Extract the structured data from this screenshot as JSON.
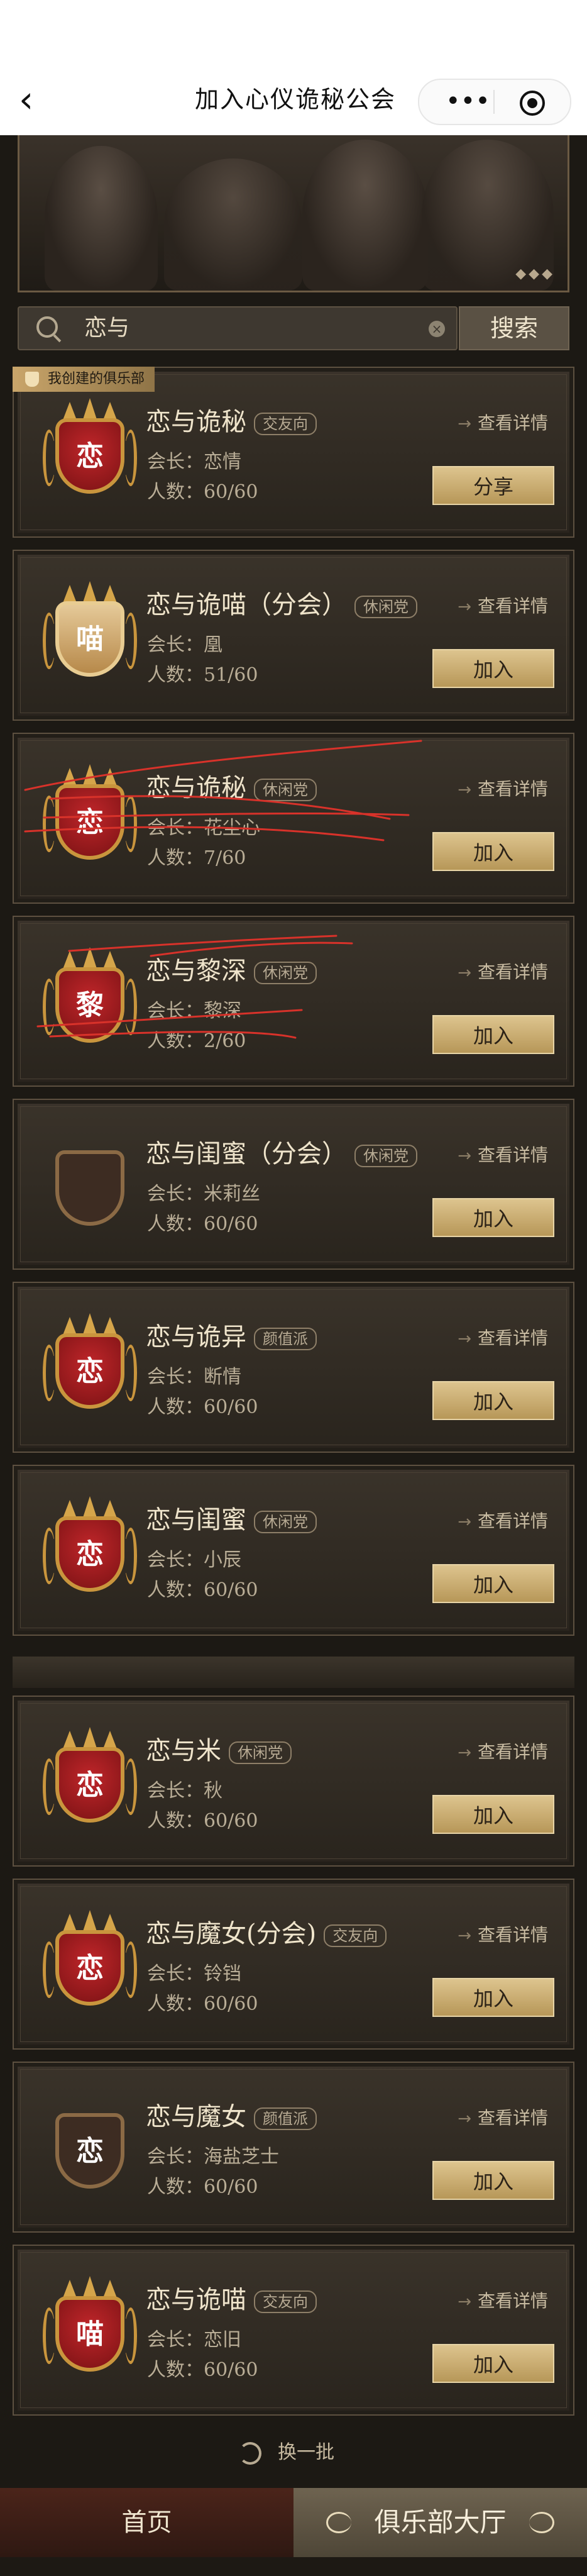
{
  "header": {
    "back_icon": "chevron-left-icon",
    "title": "加入心仪诡秘公会",
    "more_icon": "more-dots-icon",
    "close_icon": "target-circle-icon"
  },
  "search": {
    "value": "恋与",
    "button": "搜索"
  },
  "mine_badge": "我创建的俱乐部",
  "detail_label": "查看详情",
  "clubs": [
    {
      "emblem": "恋",
      "name": "恋与诡秘",
      "tag": "交友向",
      "leader": "会长：恋情",
      "members": "人数：60/60",
      "action": "分享"
    },
    {
      "emblem": "喵",
      "name": "恋与诡喵（分会）",
      "tag": "休闲党",
      "leader": "会长：凰",
      "members": "人数：51/60",
      "action": "加入"
    },
    {
      "emblem": "恋",
      "name": "恋与诡秘",
      "tag": "休闲党",
      "leader": "会长：花尘心",
      "members": "人数：7/60",
      "action": "加入"
    },
    {
      "emblem": "黎",
      "name": "恋与黎深",
      "tag": "休闲党",
      "leader": "会长：黎深",
      "members": "人数：2/60",
      "action": "加入"
    },
    {
      "emblem": "",
      "name": "恋与闺蜜（分会）",
      "tag": "休闲党",
      "leader": "会长：米莉丝",
      "members": "人数：60/60",
      "action": "加入"
    },
    {
      "emblem": "恋",
      "name": "恋与诡异",
      "tag": "颜值派",
      "leader": "会长：断情",
      "members": "人数：60/60",
      "action": "加入"
    },
    {
      "emblem": "恋",
      "name": "恋与闺蜜",
      "tag": "休闲党",
      "leader": "会长：小辰",
      "members": "人数：60/60",
      "action": "加入"
    },
    {
      "emblem": "恋",
      "name": "恋与米",
      "tag": "休闲党",
      "leader": "会长：秋",
      "members": "人数：60/60",
      "action": "加入"
    },
    {
      "emblem": "恋",
      "name": "恋与魔女(分会)",
      "tag": "交友向",
      "leader": "会长：铃铛",
      "members": "人数：60/60",
      "action": "加入"
    },
    {
      "emblem": "恋",
      "name": "恋与魔女",
      "tag": "颜值派",
      "leader": "会长：海盐芝士",
      "members": "人数：60/60",
      "action": "加入"
    },
    {
      "emblem": "喵",
      "name": "恋与诡喵",
      "tag": "交友向",
      "leader": "会长：恋旧",
      "members": "人数：60/60",
      "action": "加入"
    }
  ],
  "refresh_label": "换一批",
  "tabs": {
    "home": "首页",
    "club_hall": "俱乐部大厅"
  },
  "colors": {
    "accent_gold": "#d5a54a",
    "crest_red": "#9e1a1a",
    "card_bg": "#2f2922",
    "scribble_red": "#d8322a"
  }
}
